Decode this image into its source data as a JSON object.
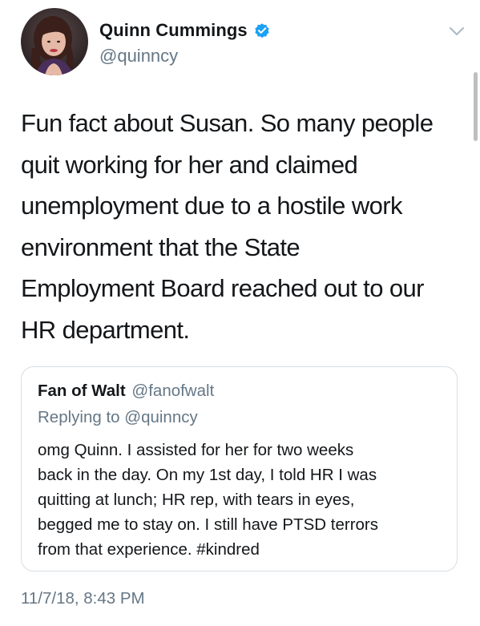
{
  "author": {
    "display_name": "Quinn Cummings",
    "handle": "@quinncy",
    "verified_icon": "verified-badge-icon",
    "avatar_icon": "avatar-photo"
  },
  "menu_icon": "chevron-down-icon",
  "tweet": {
    "lines": [
      "Fun fact about Susan. So many people",
      "quit working for her and claimed",
      "unemployment due to a hostile work",
      "environment that the State",
      "Employment Board reached out to our",
      "HR department."
    ]
  },
  "quoted_tweet": {
    "display_name": "Fan of Walt",
    "handle": "@fanofwalt",
    "replying_to": "Replying to @quinncy",
    "lines": [
      "omg Quinn. I assisted for her for two weeks",
      "back in the day. On my 1st day, I told HR I was",
      "quitting at lunch; HR rep, with tears in eyes,",
      "begged me to stay on. I still have PTSD terrors",
      "from that experience. #kindred"
    ]
  },
  "timestamp": "11/7/18, 8:43 PM",
  "colors": {
    "text_primary": "#14171a",
    "text_secondary": "#657786",
    "verified_blue": "#1da1f2",
    "border": "#d6dee4"
  }
}
